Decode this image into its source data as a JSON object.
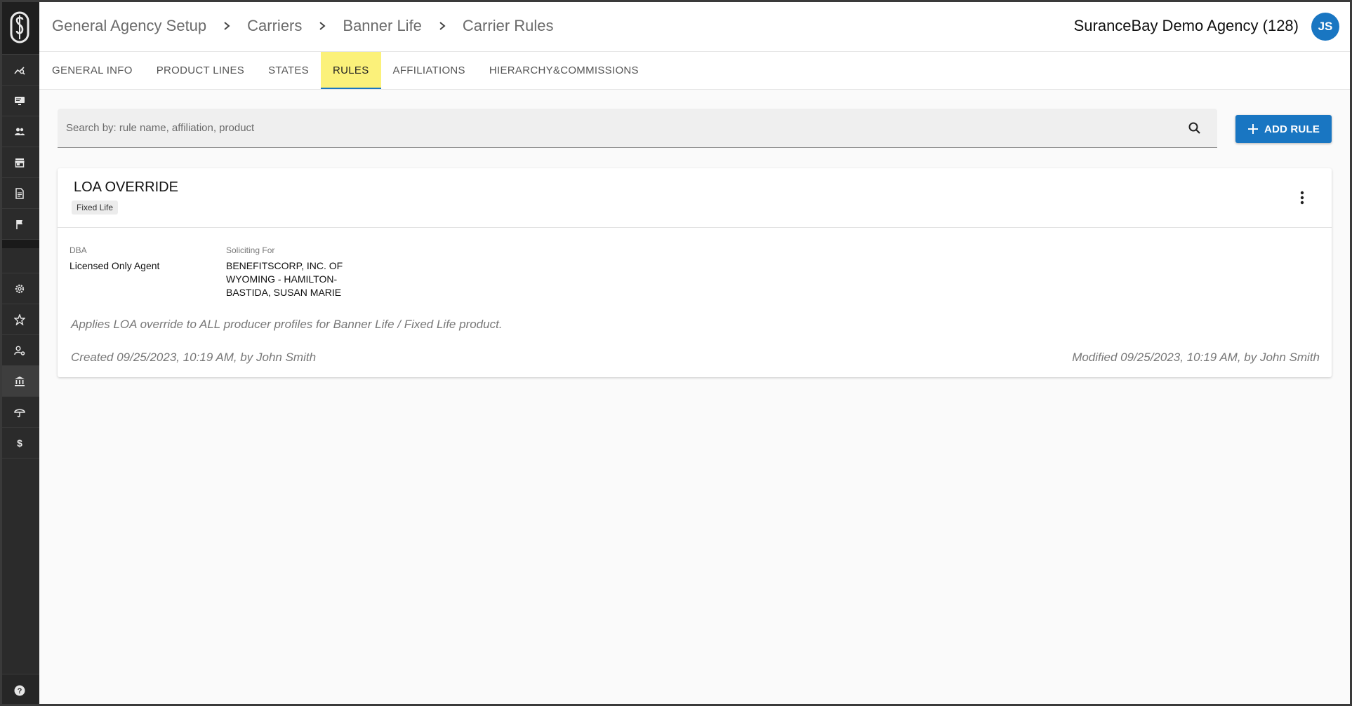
{
  "sidebar": {
    "items_top": [
      {
        "icon": "analytics-icon"
      },
      {
        "icon": "monitor-icon"
      },
      {
        "icon": "people-icon"
      },
      {
        "icon": "store-icon"
      },
      {
        "icon": "document-icon"
      },
      {
        "icon": "flag-icon"
      }
    ],
    "items_bottom": [
      {
        "icon": "gear-icon"
      },
      {
        "icon": "star-badge-icon"
      },
      {
        "icon": "user-settings-icon"
      },
      {
        "icon": "bank-icon",
        "active": true
      },
      {
        "icon": "umbrella-icon"
      },
      {
        "icon": "dollar-icon"
      }
    ]
  },
  "header": {
    "breadcrumbs": [
      "General Agency Setup",
      "Carriers",
      "Banner Life",
      "Carrier Rules"
    ],
    "agency": "SuranceBay Demo Agency (128)",
    "avatar_initials": "JS"
  },
  "tabs": [
    {
      "label": "GENERAL INFO"
    },
    {
      "label": "PRODUCT LINES"
    },
    {
      "label": "STATES"
    },
    {
      "label": "RULES",
      "active": true
    },
    {
      "label": "AFFILIATIONS"
    },
    {
      "label": "HIERARCHY&COMMISSIONS"
    }
  ],
  "search": {
    "placeholder": "Search by: rule name, affiliation, product",
    "value": ""
  },
  "add_button": {
    "label": "ADD RULE"
  },
  "rule_card": {
    "title": "LOA OVERRIDE",
    "chip": "Fixed Life",
    "dba_label": "DBA",
    "dba_value": "Licensed Only Agent",
    "soliciting_label": "Soliciting For",
    "soliciting_lines": [
      "BENEFITSCORP, INC. OF",
      "WYOMING - HAMILTON-",
      "BASTIDA, SUSAN MARIE"
    ],
    "description": "Applies LOA override to ALL producer profiles for Banner Life / Fixed Life product.",
    "created": "Created 09/25/2023, 10:19 AM, by John Smith",
    "modified": "Modified 09/25/2023, 10:19 AM, by John Smith"
  },
  "colors": {
    "accent": "#1976c2",
    "active_tab_highlight": "#fbf17a",
    "sidebar_bg": "#2b2b2b"
  }
}
